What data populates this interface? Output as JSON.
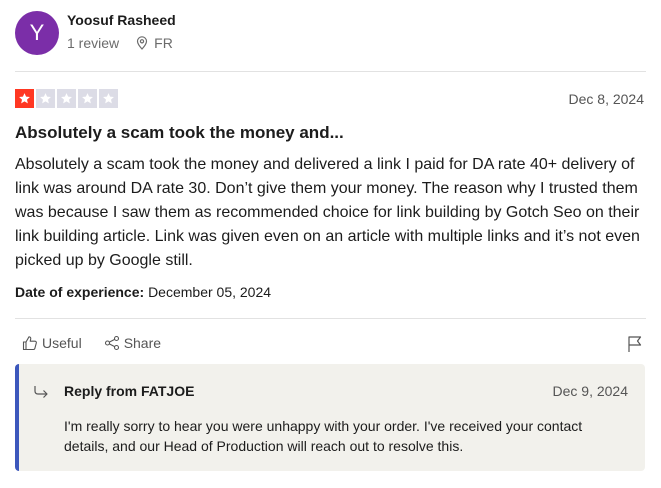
{
  "reviewer": {
    "avatar_letter": "Y",
    "avatar_color": "#7b2ea8",
    "name": "Yoosuf Rasheed",
    "review_count": "1 review",
    "country": "FR"
  },
  "review": {
    "rating": 1,
    "max_rating": 5,
    "star_color_filled": "#ff3722",
    "star_color_empty": "#dcdce6",
    "date": "Dec 8, 2024",
    "title": "Absolutely a scam took the money and...",
    "body": "Absolutely a scam took the money and delivered a link I paid for DA rate 40+ delivery of link was around DA rate 30. Don’t give them your money. The reason why I trusted them was because I saw them as recommended choice for link building by Gotch Seo on their link building article. Link was given even on an article with multiple links and it’s not even picked up by Google still.",
    "experience_label": "Date of experience:",
    "experience_date": "December 05, 2024"
  },
  "actions": {
    "useful_label": "Useful",
    "share_label": "Share",
    "useful_icon": "thumbs-up-icon",
    "share_icon": "share-icon",
    "flag_icon": "flag-icon"
  },
  "reply": {
    "from_label": "Reply from FATJOE",
    "date": "Dec 9, 2024",
    "text": "I'm really sorry to hear you were unhappy with your order. I've received your contact details, and our Head of Production will reach out to resolve this.",
    "accent_color": "#3c57bc",
    "icon": "reply-arrow-icon"
  }
}
